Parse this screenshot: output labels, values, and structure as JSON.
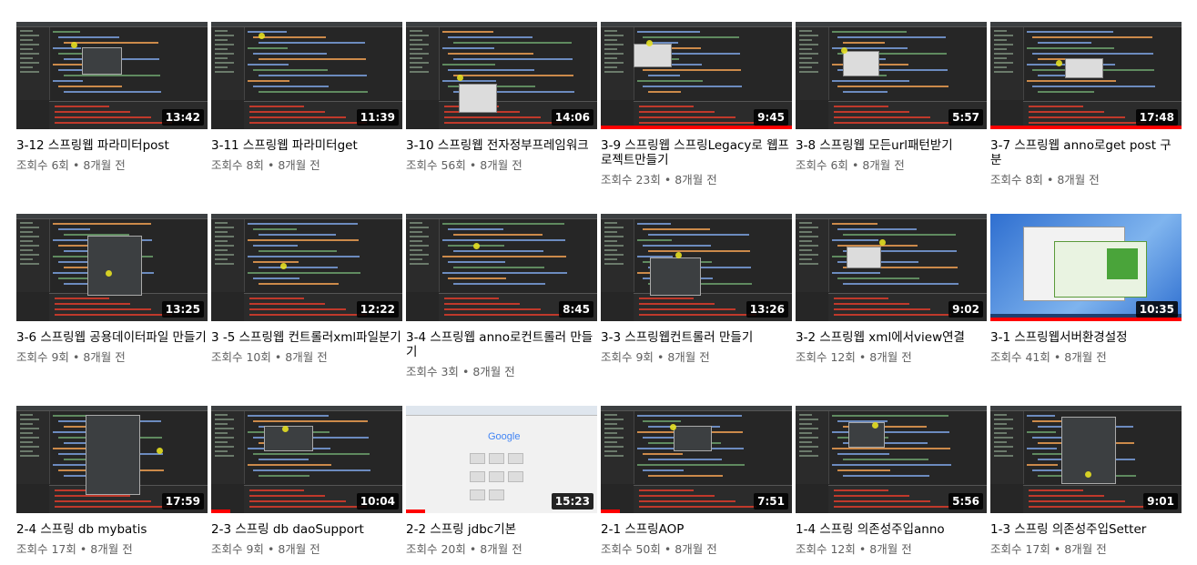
{
  "videos": [
    {
      "title": "3-12 스프링웹 파라미터post",
      "views": "조회수 6회",
      "age": "8개월 전",
      "duration": "13:42",
      "progress": 0,
      "style": "ide"
    },
    {
      "title": "3-11 스프링웹 파라미터get",
      "views": "조회수 8회",
      "age": "8개월 전",
      "duration": "11:39",
      "progress": 0,
      "style": "ide"
    },
    {
      "title": "3-10 스프링웹 전자정부프레임워크",
      "views": "조회수 56회",
      "age": "8개월 전",
      "duration": "14:06",
      "progress": 0,
      "style": "ide"
    },
    {
      "title": "3-9 스프링웹 스프링Legacy로 웹프로젝트만들기",
      "views": "조회수 23회",
      "age": "8개월 전",
      "duration": "9:45",
      "progress": 1,
      "style": "ide"
    },
    {
      "title": "3-8 스프링웹 모든url패턴받기",
      "views": "조회수 6회",
      "age": "8개월 전",
      "duration": "5:57",
      "progress": 0,
      "style": "ide"
    },
    {
      "title": "3-7 스프링웹 anno로get post 구분",
      "views": "조회수 8회",
      "age": "8개월 전",
      "duration": "17:48",
      "progress": 1,
      "style": "ide"
    },
    {
      "title": "3-6 스프링웹 공용데이터파일 만들기",
      "views": "조회수 9회",
      "age": "8개월 전",
      "duration": "13:25",
      "progress": 0,
      "style": "ide"
    },
    {
      "title": "3 -5 스프링웹 컨트롤러xml파일분기",
      "views": "조회수 10회",
      "age": "8개월 전",
      "duration": "12:22",
      "progress": 0,
      "style": "ide"
    },
    {
      "title": "3-4 스프링웹 anno로컨트롤러 만들기",
      "views": "조회수 3회",
      "age": "8개월 전",
      "duration": "8:45",
      "progress": 0,
      "style": "ide"
    },
    {
      "title": "3-3 스프링웹컨트롤러 만들기",
      "views": "조회수 9회",
      "age": "8개월 전",
      "duration": "13:26",
      "progress": 0,
      "style": "ide"
    },
    {
      "title": "3-2 스프링웹 xml에서view연결",
      "views": "조회수 12회",
      "age": "8개월 전",
      "duration": "9:02",
      "progress": 0,
      "style": "ide"
    },
    {
      "title": "3-1 스프링웹서버환경설정",
      "views": "조회수 41회",
      "age": "8개월 전",
      "duration": "10:35",
      "progress": 1,
      "style": "desktop"
    },
    {
      "title": "2-4 스프링 db mybatis",
      "views": "조회수 17회",
      "age": "8개월 전",
      "duration": "17:59",
      "progress": 0,
      "style": "ide"
    },
    {
      "title": "2-3 스프링 db daoSupport",
      "views": "조회수 9회",
      "age": "8개월 전",
      "duration": "10:04",
      "progress": 0.1,
      "style": "ide"
    },
    {
      "title": "2-2 스프링 jdbc기본",
      "views": "조회수 20회",
      "age": "8개월 전",
      "duration": "15:23",
      "progress": 0.1,
      "style": "browser"
    },
    {
      "title": "2-1 스프링AOP",
      "views": "조회수 50회",
      "age": "8개월 전",
      "duration": "7:51",
      "progress": 0.1,
      "style": "ide"
    },
    {
      "title": "1-4 스프링 의존성주입anno",
      "views": "조회수 12회",
      "age": "8개월 전",
      "duration": "5:56",
      "progress": 0,
      "style": "ide"
    },
    {
      "title": "1-3 스프링 의존성주입Setter",
      "views": "조회수 17회",
      "age": "8개월 전",
      "duration": "9:01",
      "progress": 0,
      "style": "ide"
    }
  ],
  "separator": "•",
  "google_logo": "Google",
  "icons": {
    "cursor": "cursor-highlight-icon"
  },
  "colors": {
    "progress": "#ff0000",
    "meta_text": "#606060",
    "title_text": "#030303"
  }
}
